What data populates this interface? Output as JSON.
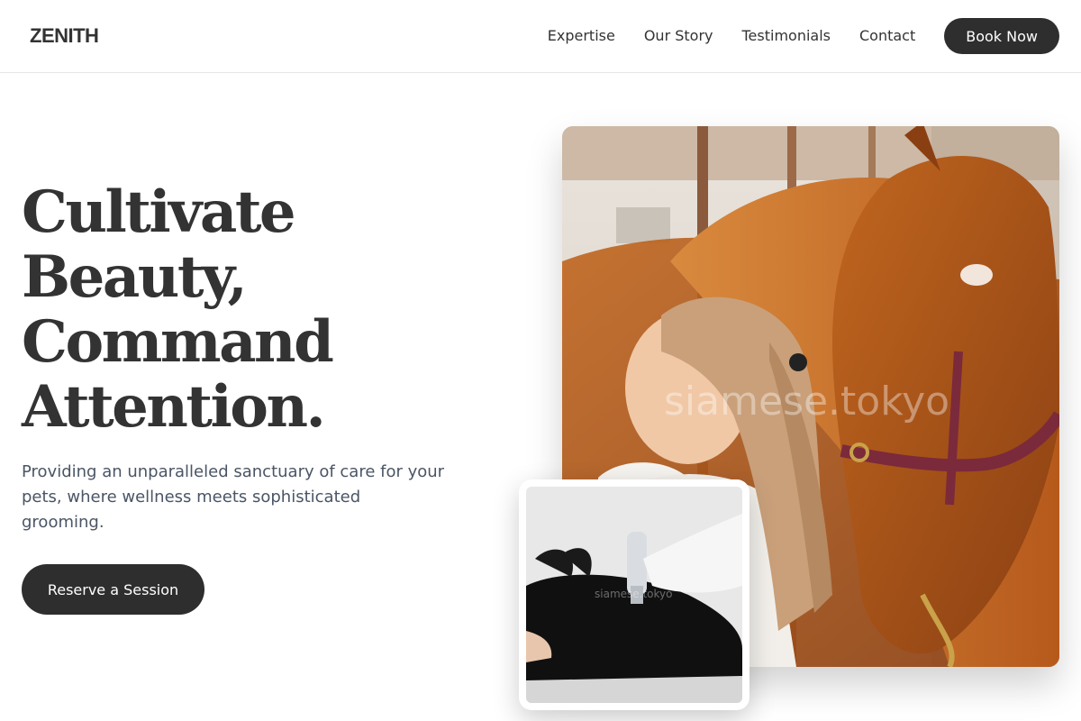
{
  "header": {
    "logo": "ZENITH",
    "nav": [
      {
        "label": "Expertise"
      },
      {
        "label": "Our Story"
      },
      {
        "label": "Testimonials"
      },
      {
        "label": "Contact"
      }
    ],
    "book_label": "Book Now"
  },
  "hero": {
    "title_lines": [
      "Cultivate",
      "Beauty,",
      "Command",
      "Attention."
    ],
    "subtitle": "Providing an unparalleled sanctuary of care for your pets, where wellness meets sophisticated grooming.",
    "cta_label": "Reserve a Session"
  },
  "images": {
    "main_watermark": "siamese.tokyo",
    "inset_watermark": "siamese.tokyo"
  },
  "colors": {
    "text": "#333333",
    "muted": "#4a5565",
    "button": "#2e2e2e",
    "button_text": "#ffffff"
  }
}
